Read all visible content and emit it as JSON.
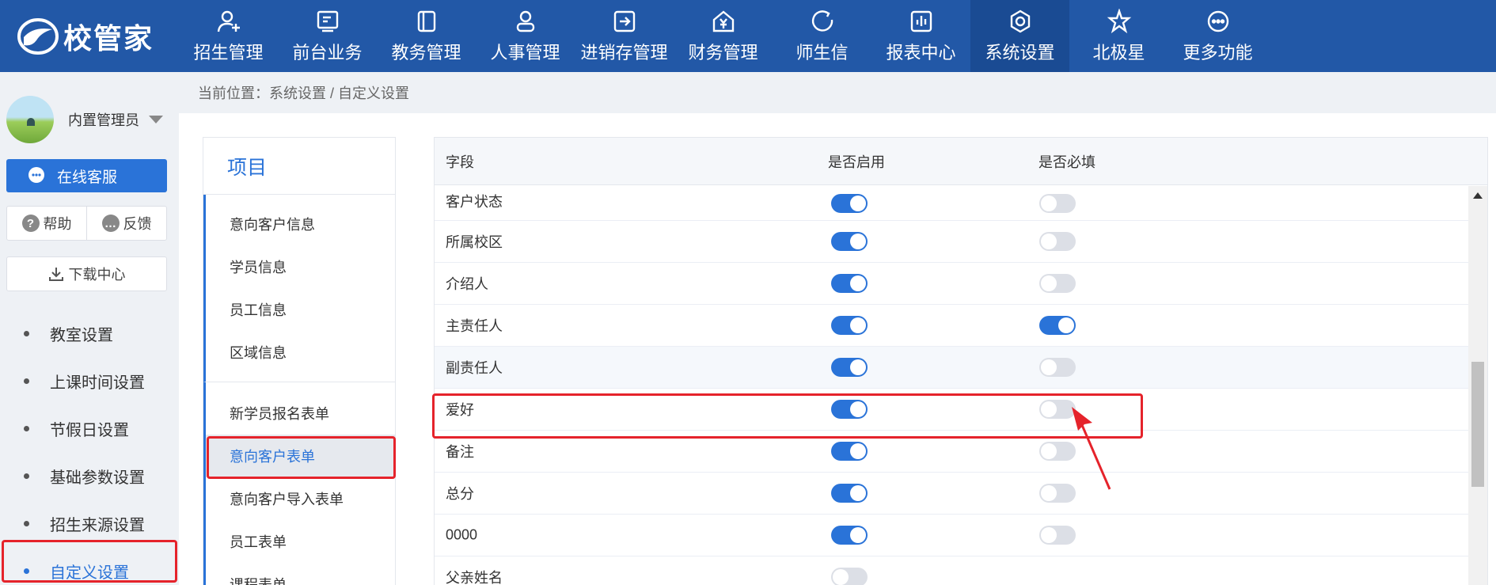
{
  "brand": {
    "name": "校管家"
  },
  "nav": {
    "items": [
      {
        "label": "招生管理",
        "icon": "user-add-icon"
      },
      {
        "label": "前台业务",
        "icon": "screen-icon"
      },
      {
        "label": "教务管理",
        "icon": "book-icon"
      },
      {
        "label": "人事管理",
        "icon": "person-icon"
      },
      {
        "label": "进销存管理",
        "icon": "arrow-box-icon"
      },
      {
        "label": "财务管理",
        "icon": "yen-house-icon"
      },
      {
        "label": "师生信",
        "icon": "chat-circle-icon"
      },
      {
        "label": "报表中心",
        "icon": "bar-chart-icon"
      },
      {
        "label": "系统设置",
        "icon": "gear-icon",
        "active": true
      },
      {
        "label": "北极星",
        "icon": "star-icon"
      },
      {
        "label": "更多功能",
        "icon": "more-icon"
      }
    ]
  },
  "sidebar": {
    "user_name": "内置管理员",
    "service_label": "在线客服",
    "help_label": "帮助",
    "feedback_label": "反馈",
    "download_label": "下载中心",
    "menu": [
      {
        "label": "教室设置"
      },
      {
        "label": "上课时间设置"
      },
      {
        "label": "节假日设置"
      },
      {
        "label": "基础参数设置"
      },
      {
        "label": "招生来源设置"
      },
      {
        "label": "自定义设置",
        "active": true
      }
    ]
  },
  "breadcrumb": {
    "text": "当前位置：系统设置 / 自定义设置"
  },
  "projects": {
    "title": "项目",
    "group1": [
      "意向客户信息",
      "学员信息",
      "员工信息",
      "区域信息"
    ],
    "group2": [
      "新学员报名表单",
      "意向客户表单",
      "意向客户导入表单",
      "员工表单",
      "课程表单"
    ],
    "active": "意向客户表单"
  },
  "table": {
    "headers": {
      "field": "字段",
      "enabled": "是否启用",
      "required": "是否必填"
    },
    "rows": [
      {
        "field": "客户状态",
        "enabled": true,
        "required": false
      },
      {
        "field": "所属校区",
        "enabled": true,
        "required": false
      },
      {
        "field": "介绍人",
        "enabled": true,
        "required": false
      },
      {
        "field": "主责任人",
        "enabled": true,
        "required": true
      },
      {
        "field": "副责任人",
        "enabled": true,
        "required": false
      },
      {
        "field": "爱好",
        "enabled": true,
        "required": false
      },
      {
        "field": "备注",
        "enabled": true,
        "required": false
      },
      {
        "field": "总分",
        "enabled": true,
        "required": false
      },
      {
        "field": "0000",
        "enabled": true,
        "required": false
      },
      {
        "field": "父亲姓名",
        "enabled": false,
        "required": null
      }
    ]
  },
  "colors": {
    "nav_bg": "#2258a7",
    "accent": "#2a73d8",
    "highlight": "#e5232b"
  }
}
